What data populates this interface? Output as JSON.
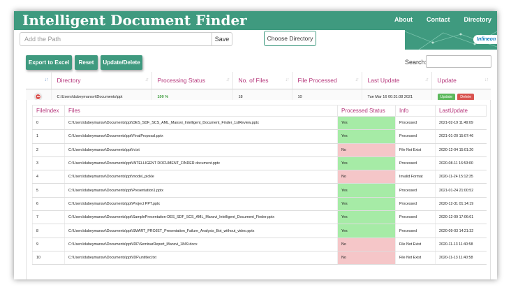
{
  "app": {
    "title": "Intelligent Document Finder"
  },
  "nav": {
    "links": [
      "About",
      "Contact",
      "Directory"
    ]
  },
  "logo": {
    "text": "Infineon"
  },
  "path": {
    "placeholder": "Add the Path",
    "save_label": "Save"
  },
  "choose_directory_label": "Choose Directory",
  "actions": {
    "export": "Export to Excel",
    "reset": "Reset",
    "update_delete": "Update/Delete"
  },
  "search": {
    "label": "Search:"
  },
  "main_table": {
    "headers": [
      "Directory",
      "Processing Status",
      "No. of Files",
      "File Processed",
      "Last Update",
      "Update"
    ],
    "row": {
      "directory": "C:\\Users\\dubeymansvi\\Documents\\ppt",
      "status": "100 %",
      "files": "18",
      "processed": "10",
      "last_update": "Tue Mar 16 00:31:08 2021",
      "update_label": "Update",
      "delete_label": "Delete"
    }
  },
  "detail": {
    "headers": [
      "FileIndex",
      "Files",
      "Processed Status",
      "Info",
      "LastUpdate"
    ],
    "rows": [
      {
        "index": "0",
        "file": "C:\\Users\\dubeymansvi\\Documents\\ppt\\DES_SDF_SCS_AML_Mansvi_Intelligent_Document_Finder_1stReview.pptx",
        "status": "Yes",
        "info": "Processed",
        "last": "2021-02-19 11:49:09"
      },
      {
        "index": "1",
        "file": "C:\\Users\\dubeymansvi\\Documents\\ppt\\FinalProposal.pptx",
        "status": "Yes",
        "info": "Processed",
        "last": "2021-01-20 15:07:46"
      },
      {
        "index": "2",
        "file": "C:\\Users\\dubeymansvi\\Documents\\ppt\\h.txt",
        "status": "No",
        "info": "File Not Exist",
        "last": "2020-12-04 15:01:20"
      },
      {
        "index": "3",
        "file": "C:\\Users\\dubeymansvi\\Documents\\ppt\\INTELLIGENT DOCUMENT_FINDER document.pptx",
        "status": "Yes",
        "info": "Processed",
        "last": "2020-08-11 16:53:00"
      },
      {
        "index": "4",
        "file": "C:\\Users\\dubeymansvi\\Documents\\ppt\\model_pickle",
        "status": "No",
        "info": "Invalid Format",
        "last": "2020-11-24 15:12:35"
      },
      {
        "index": "5",
        "file": "C:\\Users\\dubeymansvi\\Documents\\ppt\\Presentation1.pptx",
        "status": "Yes",
        "info": "Processed",
        "last": "2021-01-24 21:00:52"
      },
      {
        "index": "6",
        "file": "C:\\Users\\dubeymansvi\\Documents\\ppt\\Project PPT.pptx",
        "status": "Yes",
        "info": "Processed",
        "last": "2020-12-31 01:14:19"
      },
      {
        "index": "7",
        "file": "C:\\Users\\dubeymansvi\\Documents\\ppt\\SamplePresentation-DES_SDF_SCS_AML_Mansvi_Intelligent_Document_Finder.pptx",
        "status": "Yes",
        "info": "Processed",
        "last": "2020-12-09 17:06:01"
      },
      {
        "index": "8",
        "file": "C:\\Users\\dubeymansvi\\Documents\\ppt\\SMART_PROJET_Presentation_Failure_Analysis_Bot_without_video.pptx",
        "status": "Yes",
        "info": "Processed",
        "last": "2020-09-03 14:21:32"
      },
      {
        "index": "9",
        "file": "C:\\Users\\dubeymansvi\\Documents\\ppt\\IDF\\SeminarReport_Mansvi_1849.docx",
        "status": "No",
        "info": "File Not Exist",
        "last": "2020-11-13 11:40:58"
      },
      {
        "index": "10",
        "file": "C:\\Users\\dubeymansvi\\Documents\\ppt\\IDF\\untitled.txt",
        "status": "No",
        "info": "File Not Exist",
        "last": "2020-11-13 11:40:58"
      }
    ]
  },
  "colors": {
    "brand": "#3f9a7f",
    "header_text": "#b5357a",
    "yes": "#a6eba6",
    "no": "#f5c6c8",
    "update_btn": "#5cb85c",
    "delete_btn": "#d9534f"
  }
}
